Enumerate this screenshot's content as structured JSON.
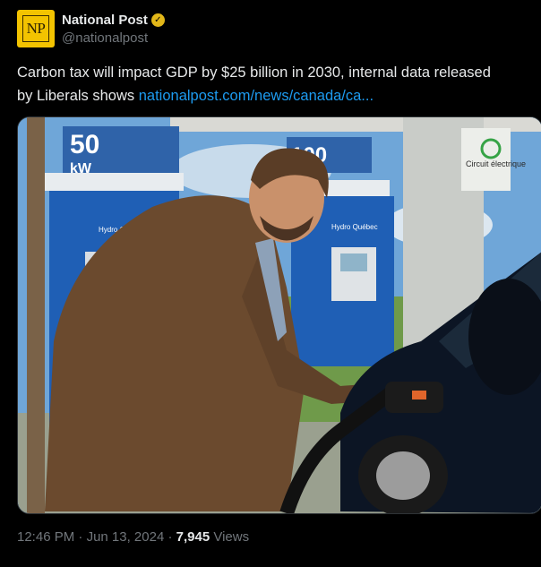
{
  "account": {
    "display_name": "National Post",
    "handle": "@nationalpost",
    "avatar_text": "NP",
    "verified_color": "#e2b719"
  },
  "tweet": {
    "text_line1": "Carbon tax will impact GDP by $25 billion in 2030, internal data released",
    "text_line2_prefix": "by Liberals shows ",
    "link_text": "nationalpost.com/news/canada/ca..."
  },
  "media": {
    "sign_left_number": "50",
    "sign_left_unit": "kW",
    "sign_right_number": "100",
    "charger_brand": "Hydro Québec",
    "circuit_text": "Circuit électrique"
  },
  "meta": {
    "time": "12:46 PM",
    "separator": " · ",
    "date": "Jun 13, 2024",
    "views_count": "7,945",
    "views_label": " Views"
  },
  "colors": {
    "link": "#1d9bf0",
    "muted": "#71767b",
    "text": "#e7e9ea"
  }
}
